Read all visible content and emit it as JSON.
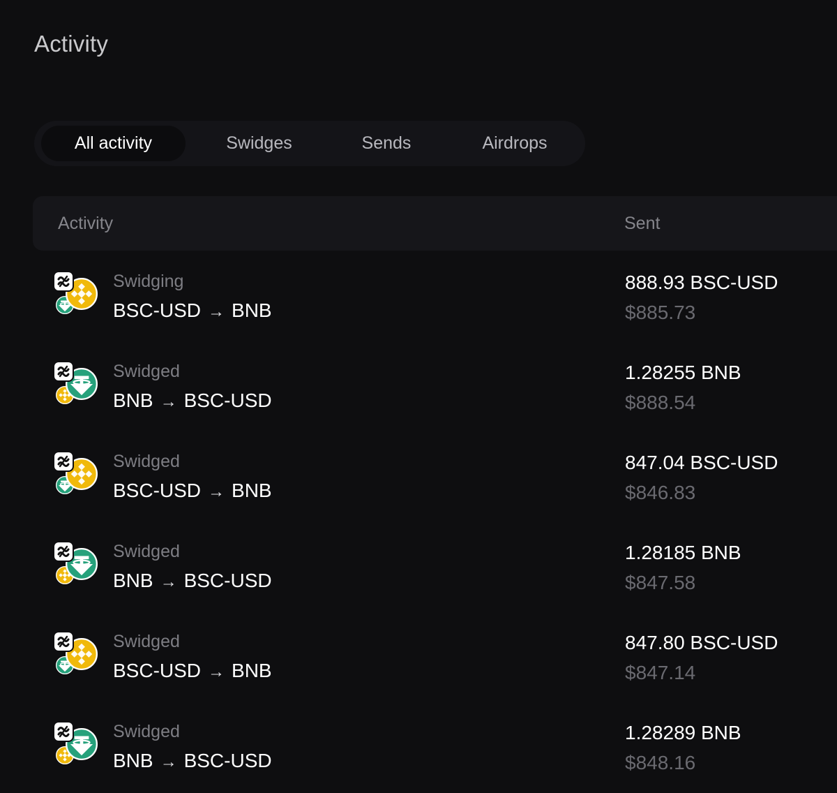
{
  "page": {
    "title": "Activity"
  },
  "tabs": [
    {
      "label": "All activity",
      "active": true
    },
    {
      "label": "Swidges",
      "active": false
    },
    {
      "label": "Sends",
      "active": false
    },
    {
      "label": "Airdrops",
      "active": false
    }
  ],
  "table": {
    "headers": {
      "activity": "Activity",
      "sent": "Sent"
    },
    "rows": [
      {
        "status": "Swidging",
        "from": "BSC-USD",
        "to": "BNB",
        "amount": "888.93 BSC-USD",
        "usd": "$885.73",
        "main_token": "bnb-icon",
        "small_token": "tether-icon"
      },
      {
        "status": "Swidged",
        "from": "BNB",
        "to": "BSC-USD",
        "amount": "1.28255 BNB",
        "usd": "$888.54",
        "main_token": "tether-icon",
        "small_token": "bnb-icon"
      },
      {
        "status": "Swidged",
        "from": "BSC-USD",
        "to": "BNB",
        "amount": "847.04 BSC-USD",
        "usd": "$846.83",
        "main_token": "bnb-icon",
        "small_token": "tether-icon"
      },
      {
        "status": "Swidged",
        "from": "BNB",
        "to": "BSC-USD",
        "amount": "1.28185 BNB",
        "usd": "$847.58",
        "main_token": "tether-icon",
        "small_token": "bnb-icon"
      },
      {
        "status": "Swidged",
        "from": "BSC-USD",
        "to": "BNB",
        "amount": "847.80 BSC-USD",
        "usd": "$847.14",
        "main_token": "bnb-icon",
        "small_token": "tether-icon"
      },
      {
        "status": "Swidged",
        "from": "BNB",
        "to": "BSC-USD",
        "amount": "1.28289 BNB",
        "usd": "$848.16",
        "main_token": "tether-icon",
        "small_token": "bnb-icon"
      }
    ]
  },
  "colors": {
    "background": "#0e0e10",
    "bnb": "#f0b90b",
    "tether": "#26a17b",
    "muted_text": "#7d7d83"
  }
}
